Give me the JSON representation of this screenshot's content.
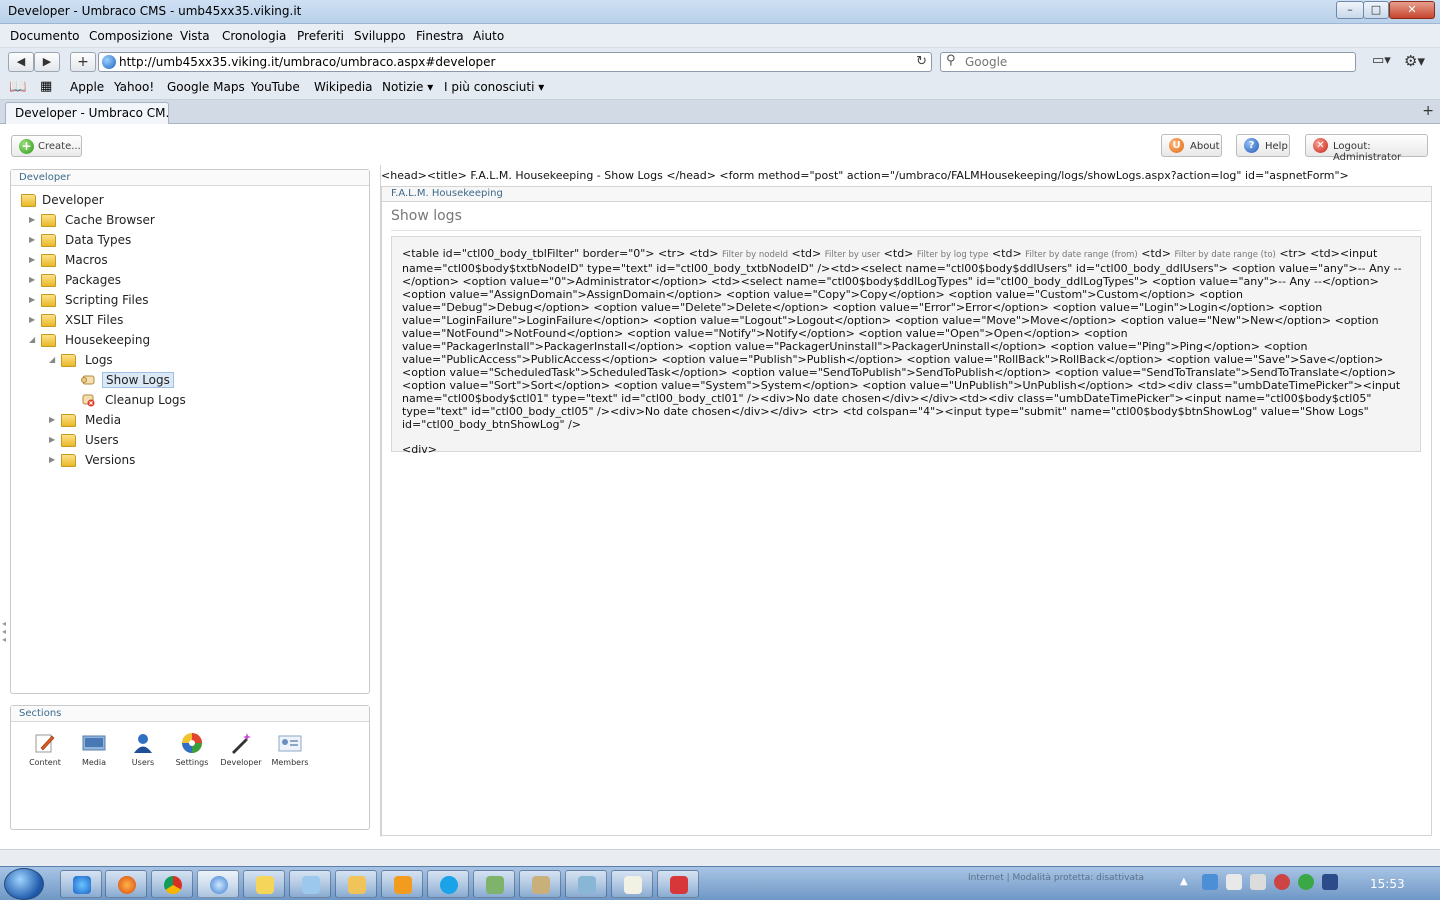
{
  "window": {
    "title": "Developer - Umbraco CMS - umb45xx35.viking.it",
    "minimize": "–",
    "maximize": "□",
    "close": "✕"
  },
  "menu": [
    "Documento",
    "Composizione",
    "Vista",
    "Cronologia",
    "Preferiti",
    "Sviluppo",
    "Finestra",
    "Aiuto"
  ],
  "nav": {
    "back": "◀",
    "forward": "▶",
    "add": "+",
    "url": "http://umb45xx35.viking.it/umbraco/umbraco.aspx#developer",
    "reload": "↻",
    "search_placeholder": "Google",
    "page_menu": "▭▾",
    "settings": "⚙▾"
  },
  "bookmarks": [
    "Apple",
    "Yahoo!",
    "Google Maps",
    "YouTube",
    "Wikipedia",
    "Notizie ▾",
    "I più conosciuti ▾"
  ],
  "tab": {
    "label": "Developer - Umbraco CM...",
    "new_tab": "+"
  },
  "toolbar": {
    "create": "Create...",
    "about": "About",
    "help": "Help",
    "logout": "Logout: Administrator"
  },
  "tree": {
    "header": "Developer",
    "nodes": [
      {
        "label": "Developer",
        "arrow": ""
      },
      {
        "label": "Cache Browser",
        "arrow": "▶"
      },
      {
        "label": "Data Types",
        "arrow": "▶"
      },
      {
        "label": "Macros",
        "arrow": "▶"
      },
      {
        "label": "Packages",
        "arrow": "▶"
      },
      {
        "label": "Scripting Files",
        "arrow": "▶"
      },
      {
        "label": "XSLT Files",
        "arrow": "▶"
      },
      {
        "label": "Housekeeping",
        "arrow": "◢"
      },
      {
        "label": "Logs",
        "arrow": "◢"
      },
      {
        "label": "Show Logs",
        "arrow": ""
      },
      {
        "label": "Cleanup Logs",
        "arrow": ""
      },
      {
        "label": "Media",
        "arrow": "▶"
      },
      {
        "label": "Users",
        "arrow": "▶"
      },
      {
        "label": "Versions",
        "arrow": "▶"
      }
    ]
  },
  "sections": {
    "header": "Sections",
    "items": [
      "Content",
      "Media",
      "Users",
      "Settings",
      "Developer",
      "Members"
    ]
  },
  "main": {
    "html_line": "<head><title> F.A.L.M. Housekeeping - Show Logs </head> <form method=\"post\" action=\"/umbraco/FALMHousekeeping/logs/showLogs.aspx?action=log\" id=\"aspnetForm\">",
    "panel_title": "F.A.L.M. Housekeeping",
    "page_title": "Show logs",
    "code": {
      "t1": "<table id=\"ctl00_body_tblFilter\" border=\"0\"> <tr> <td> ",
      "s1": "Filter by nodeId",
      "t2": " <td> ",
      "s2": "Filter by user",
      "t3": " <td> ",
      "s3": "Filter by log type",
      "t4": " <td> ",
      "s4": "Filter by date range (from)",
      "t5": " <td> ",
      "s5": "Filter by date range (to)",
      "t6": " <tr> <td><input name=\"ctl00$body$txtbNodeID\" type=\"text\" id=\"ctl00_body_txtbNodeID\" /><td><select name=\"ctl00$body$ddlUsers\" id=\"ctl00_body_ddlUsers\"> <option value=\"any\">-- Any --</option> <option value=\"0\">Administrator</option> <td><select name=\"ctl00$body$ddlLogTypes\" id=\"ctl00_body_ddlLogTypes\"> <option value=\"any\">-- Any --</option> <option value=\"AssignDomain\">AssignDomain</option> <option value=\"Copy\">Copy</option> <option value=\"Custom\">Custom</option> <option value=\"Debug\">Debug</option> <option value=\"Delete\">Delete</option> <option value=\"Error\">Error</option> <option value=\"Login\">Login</option> <option value=\"LoginFailure\">LoginFailure</option> <option value=\"Logout\">Logout</option> <option value=\"Move\">Move</option> <option value=\"New\">New</option> <option value=\"NotFound\">NotFound</option> <option value=\"Notify\">Notify</option> <option value=\"Open\">Open</option> <option value=\"PackagerInstall\">PackagerInstall</option> <option value=\"PackagerUninstall\">PackagerUninstall</option> <option value=\"Ping\">Ping</option> <option value=\"PublicAccess\">PublicAccess</option> <option value=\"Publish\">Publish</option> <option value=\"RollBack\">RollBack</option> <option value=\"Save\">Save</option> <option value=\"ScheduledTask\">ScheduledTask</option> <option value=\"SendToPublish\">SendToPublish</option> <option value=\"SendToTranslate\">SendToTranslate</option> <option value=\"Sort\">Sort</option> <option value=\"System\">System</option> <option value=\"UnPublish\">UnPublish</option> <td><div class=\"umbDateTimePicker\"><input name=\"ctl00$body$ctl01\" type=\"text\" id=\"ctl00_body_ctl01\" /><div>No date chosen</div></div><td><div class=\"umbDateTimePicker\"><input name=\"ctl00$body$ctl05\" type=\"text\" id=\"ctl00_body_ctl05\" /><div>No date chosen</div></div> <tr> <td colspan=\"4\"><input type=\"submit\" name=\"ctl00$body$btnShowLog\" value=\"Show Logs\" id=\"ctl00_body_btnShowLog\" />",
      "tail": "<div>"
    }
  },
  "taskbar": {
    "tray_text": "Internet | Modalità protetta: disattivata",
    "clock": "15:53"
  },
  "colors": {
    "accent": "#3c6a8c",
    "selection": "#dbe9f7",
    "folder": "#e9b829"
  }
}
